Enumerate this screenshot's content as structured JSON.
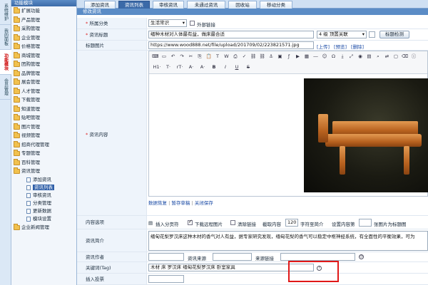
{
  "rail": {
    "tabs": [
      {
        "label": "系统维护",
        "active": false
      },
      {
        "label": "我的面板",
        "active": false
      },
      {
        "label": "功能模块",
        "active": true
      },
      {
        "label": "会员管理",
        "active": false
      }
    ]
  },
  "sidebar": {
    "header": "功能模块",
    "items": [
      {
        "label": "扩展功能"
      },
      {
        "label": "产品管理"
      },
      {
        "label": "采购管理"
      },
      {
        "label": "企业管理"
      },
      {
        "label": "价格管理"
      },
      {
        "label": "商城管理"
      },
      {
        "label": "团购管理"
      },
      {
        "label": "品牌管理"
      },
      {
        "label": "展会管理"
      },
      {
        "label": "人才管理"
      },
      {
        "label": "下载管理"
      },
      {
        "label": "知道管理"
      },
      {
        "label": "贴吧管理"
      },
      {
        "label": "图片管理"
      },
      {
        "label": "视频管理"
      },
      {
        "label": "招商代理管理"
      },
      {
        "label": "专题管理"
      },
      {
        "label": "百科管理"
      },
      {
        "label": "资讯管理"
      }
    ],
    "children": [
      {
        "label": "添加资讯",
        "selected": false
      },
      {
        "label": "资讯列表",
        "selected": true
      },
      {
        "label": "审核资讯",
        "selected": false
      },
      {
        "label": "分类管理",
        "selected": false
      },
      {
        "label": "更新数据",
        "selected": false
      },
      {
        "label": "模块设置",
        "selected": false
      }
    ],
    "last_item": "企业新闻管理"
  },
  "tabs": [
    {
      "label": "添加资讯",
      "active": false
    },
    {
      "label": "资讯列表",
      "active": true
    },
    {
      "label": "审核资讯",
      "active": false
    },
    {
      "label": "未通过资讯",
      "active": false
    },
    {
      "label": "回收站",
      "active": false
    },
    {
      "label": "移动分类",
      "active": false
    }
  ],
  "section_title": "修改资讯",
  "form": {
    "category": {
      "label": "所属分类",
      "value": "生活常识",
      "external_link_label": "外部链接"
    },
    "title": {
      "label": "资讯标题",
      "value": "缅种木材对人体最有益，做床最合适",
      "level": "4 级  顶置关联",
      "detect_button": "标题检测"
    },
    "image": {
      "label": "标题图片",
      "value": "https://www.wood888.net/file/upload/201709/02/223821571.jpg",
      "upload": "[上传]",
      "preview": "[预览]",
      "delete": "[删除]"
    },
    "content": {
      "label": "资讯内容"
    },
    "editor_links": [
      "数据恢复",
      "暂存草稿",
      "关闭保存"
    ],
    "options": {
      "label": "内容选项",
      "insert_page": "插入分页符",
      "download_images": "下载远程图片",
      "clear_links": "清除链接",
      "intro_cut": "截取内容",
      "intro_count": "120",
      "intro_cut_suffix": "字符至简介",
      "set_content": "设置内容第",
      "set_content_suffix": "张图片为标题图"
    },
    "intro": {
      "label": "资讯简介",
      "value": "缅甸花梨罗汉床这种木材的香气对人有益，据专家研究发现，缅甸花梨的香气可以稳定中枢神经系统，有全面性的平衡效果，可为"
    },
    "author": {
      "label": "资讯作者",
      "source_label": "资讯来源",
      "source_link_label": "来源链接"
    },
    "keywords": {
      "label": "关键词(Tag)",
      "value": "木材 床 罗汉床 缅甸花梨罗汉床 卧室家具"
    },
    "more": {
      "label": "插入投票"
    }
  },
  "toolbar": {
    "row1": [
      "code-icon",
      "new-doc-icon",
      "undo-icon",
      "redo-icon",
      "cut-icon",
      "copy-icon",
      "paste-icon",
      "paste-text-icon",
      "paste-word-icon",
      "print-icon",
      "spellcheck-icon",
      "link-icon",
      "unlink-icon",
      "anchor-icon",
      "image-icon",
      "flash-icon",
      "media-icon",
      "table-icon",
      "hr-icon",
      "smiley-icon",
      "special-char-icon",
      "pagebreak-icon",
      "fullscreen-icon",
      "preview-icon",
      "template-icon",
      "find-icon",
      "replace-icon",
      "select-all-icon",
      "remove-format-icon",
      "about-icon"
    ],
    "row2_labels": [
      "H1·",
      "T·",
      "rT·",
      "A·",
      "A·",
      "B",
      "I",
      "U",
      "S"
    ]
  }
}
